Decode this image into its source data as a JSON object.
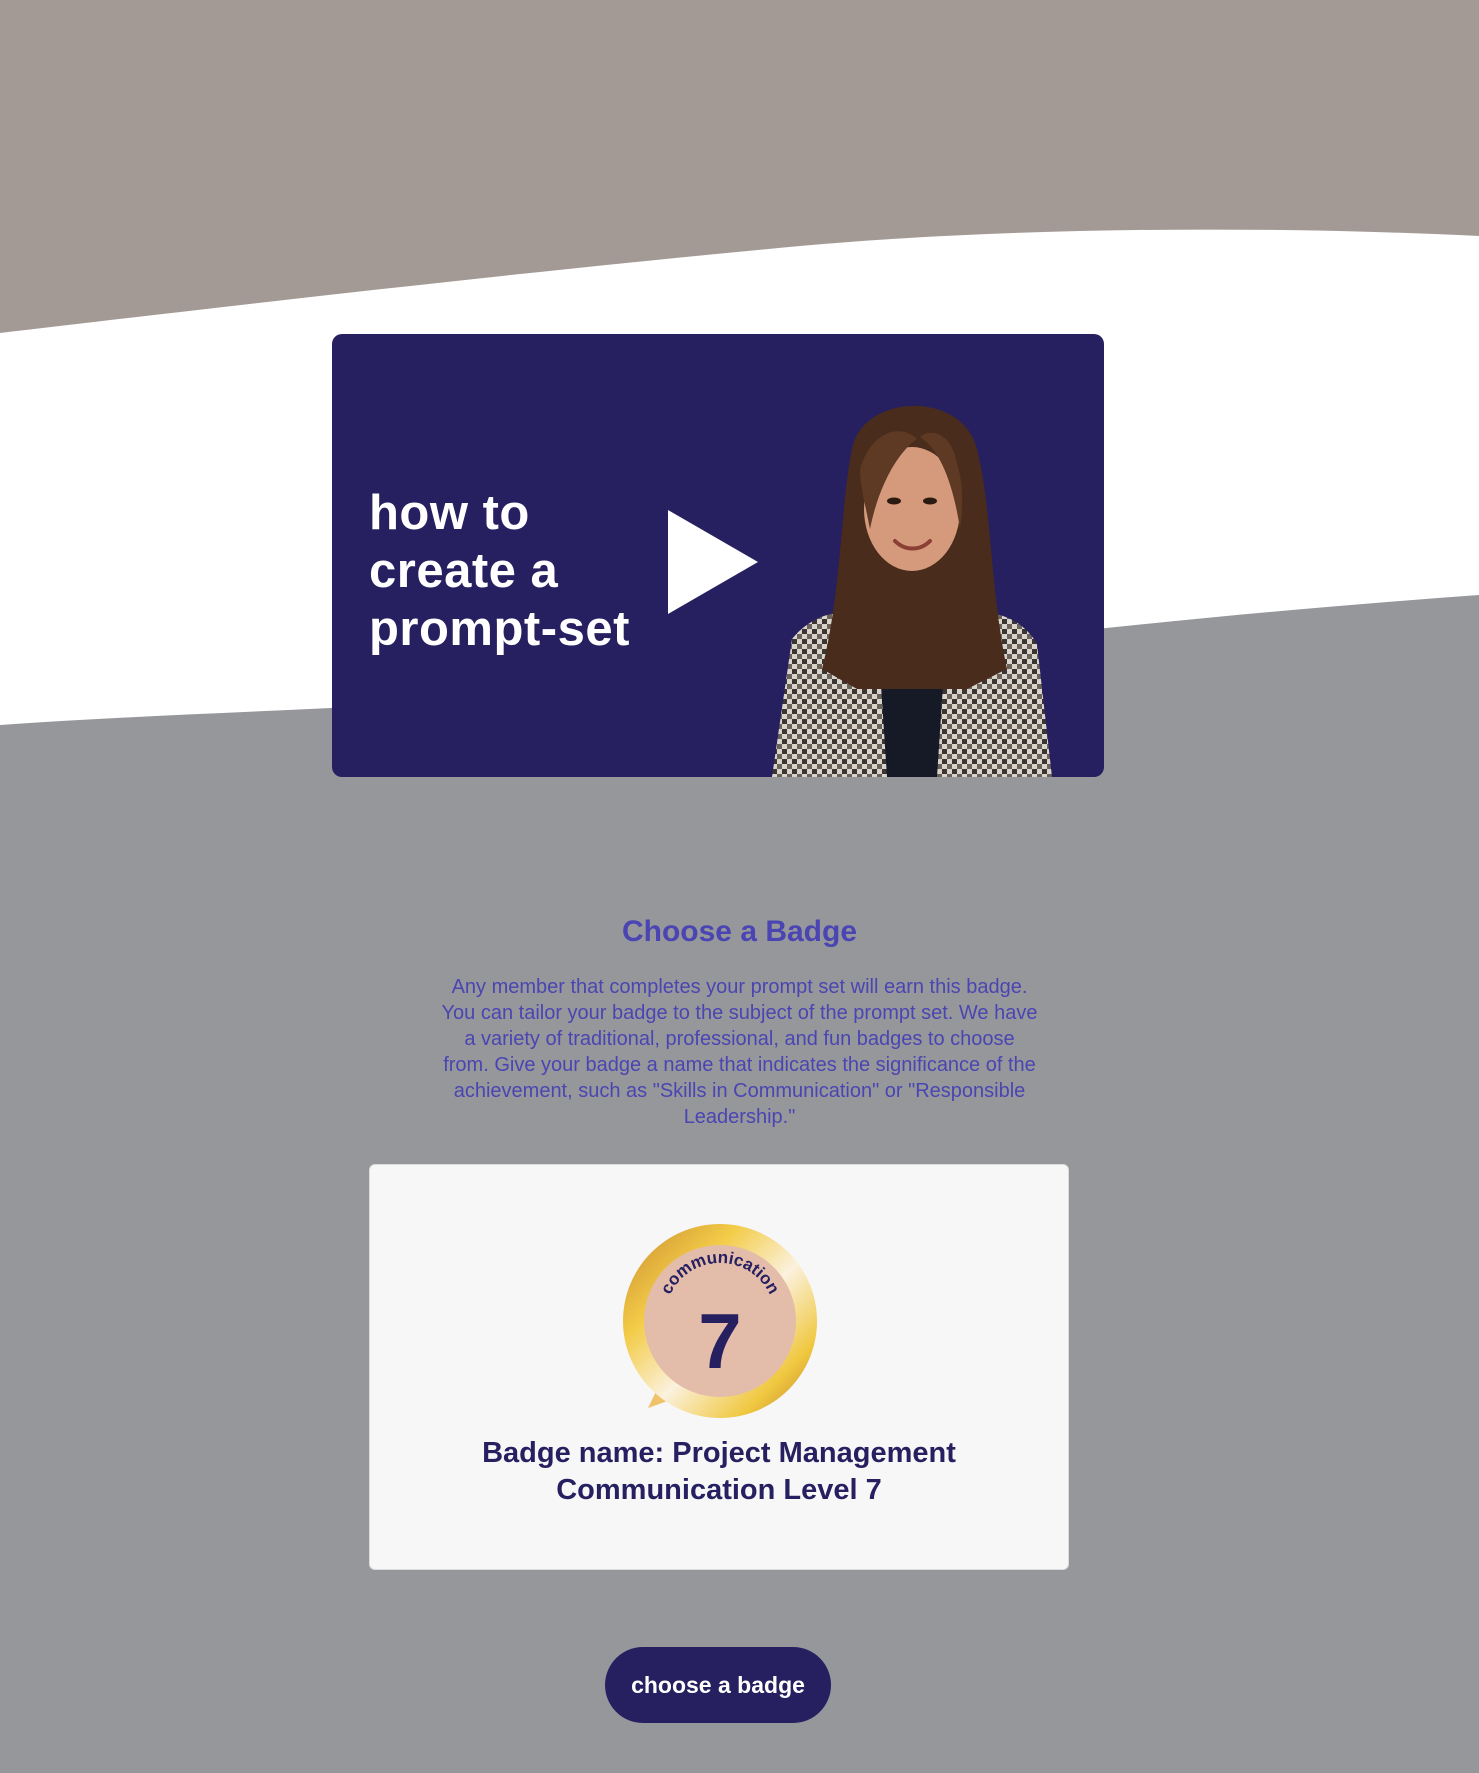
{
  "colors": {
    "top_band": "#a39a96",
    "white_band": "#ffffff",
    "bottom_band": "#96979b",
    "navy": "#261f60",
    "accent_text": "#4a45b2",
    "card_bg": "#f7f7f7",
    "badge_gold": "#e8b04a",
    "badge_inner": "#e3bcaa"
  },
  "video": {
    "title_lines": [
      "how to",
      "create a",
      "prompt-set"
    ],
    "play_icon": "play-icon",
    "presenter_image": "presenter-photo"
  },
  "badge_section": {
    "title": "Choose a Badge",
    "description": "Any member that completes your prompt set will earn this badge. You can tailor your badge to the subject of the prompt set. We have a variety of traditional, professional, and fun badges to choose from. Give your badge a name that indicates the significance of the achievement, such as \"Skills in Communication\" or \"Responsible Leadership.\""
  },
  "badge_card": {
    "arc_text": "communication",
    "level_number": "7",
    "name_line1": "Badge name: Project Management",
    "name_line2": "Communication Level 7"
  },
  "cta": {
    "label": "choose a badge"
  }
}
